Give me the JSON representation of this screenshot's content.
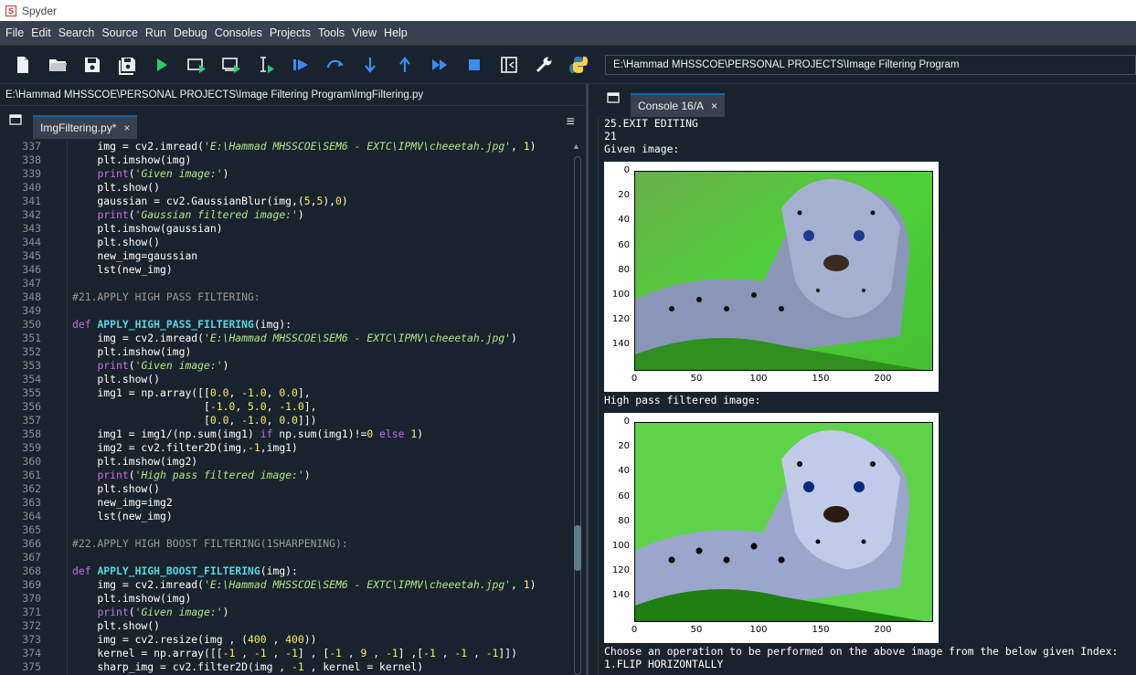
{
  "app": {
    "title": "Spyder",
    "logo": "S"
  },
  "menu": [
    "File",
    "Edit",
    "Search",
    "Source",
    "Run",
    "Debug",
    "Consoles",
    "Projects",
    "Tools",
    "View",
    "Help"
  ],
  "toolbar": {
    "buttons": [
      "new-file-icon",
      "open-folder-icon",
      "save-icon",
      "save-all-icon",
      "run-icon",
      "run-cell-icon",
      "run-cell-advance-icon",
      "run-selection-icon",
      "debug-icon",
      "step-icon",
      "step-into-icon",
      "step-return-icon",
      "continue-icon",
      "stop-icon",
      "maximize-pane-icon",
      "preferences-icon",
      "python-path-icon"
    ],
    "working_dir": "E:\\Hammad MHSSCOE\\PERSONAL PROJECTS\\Image Filtering Program"
  },
  "editor": {
    "file_path": "E:\\Hammad MHSSCOE\\PERSONAL PROJECTS\\Image Filtering Program\\ImgFiltering.py",
    "tab_label": "ImgFiltering.py*",
    "close_glyph": "×",
    "line_numbers": [
      "337",
      "338",
      "339",
      "340",
      "341",
      "342",
      "343",
      "344",
      "345",
      "346",
      "347",
      "348",
      "349",
      "350",
      "351",
      "352",
      "353",
      "354",
      "355",
      "356",
      "357",
      "358",
      "359",
      "360",
      "361",
      "362",
      "363",
      "364",
      "365",
      "366",
      "367",
      "368",
      "369",
      "370",
      "371",
      "372",
      "373",
      "374",
      "375"
    ]
  },
  "console": {
    "tab_label": "Console 16/A",
    "close_glyph": "×",
    "lines_top": [
      "25.EXIT EDITING",
      "21",
      "Given image:"
    ],
    "label_mid": "High pass filtered image:",
    "lines_bottom": [
      "Choose an operation to be performed on the above image from the below given Index:",
      "1.FLIP HORIZONTALLY"
    ],
    "plot_yticks": [
      "0",
      "20",
      "40",
      "60",
      "80",
      "100",
      "120",
      "140"
    ],
    "plot_xticks": [
      "0",
      "50",
      "100",
      "150",
      "200"
    ]
  },
  "colors": {
    "bg": "#19232d",
    "menubar": "#37414f",
    "accent": "#1464a0"
  }
}
